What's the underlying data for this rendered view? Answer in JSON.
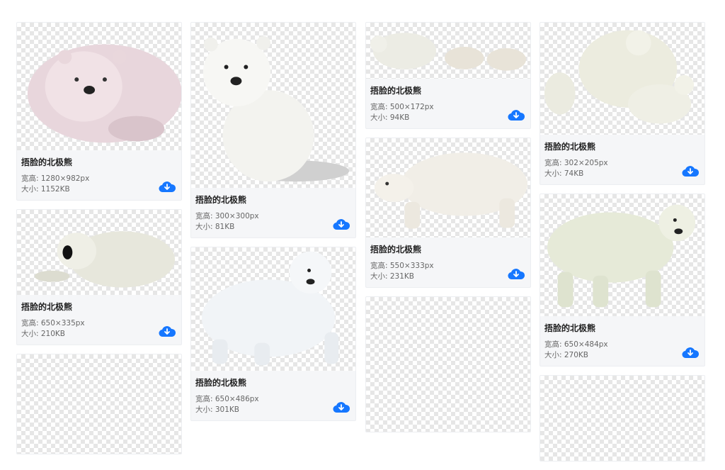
{
  "cards": [
    {
      "title": "捂脸的北极熊",
      "size_line": "宽高: 1280×982px",
      "file_line": "大小: 1152KB",
      "icon": "cloud-download-icon"
    },
    {
      "title": "捂脸的北极熊",
      "size_line": "宽高: 650×335px",
      "file_line": "大小: 210KB",
      "icon": "cloud-download-icon"
    },
    {
      "title": "捂脸的北极熊",
      "size_line": "宽高: 300×300px",
      "file_line": "大小: 81KB",
      "icon": "cloud-download-icon"
    },
    {
      "title": "捂脸的北极熊",
      "size_line": "宽高: 650×486px",
      "file_line": "大小: 301KB",
      "icon": "cloud-download-icon"
    },
    {
      "title": "捂脸的北极熊",
      "size_line": "宽高: 500×172px",
      "file_line": "大小: 94KB",
      "icon": "cloud-download-icon"
    },
    {
      "title": "捂脸的北极熊",
      "size_line": "宽高: 550×333px",
      "file_line": "大小: 231KB",
      "icon": "cloud-download-icon"
    },
    {
      "title": "捂脸的北极熊",
      "size_line": "宽高: 302×205px",
      "file_line": "大小: 74KB",
      "icon": "cloud-download-icon"
    },
    {
      "title": "捂脸的北极熊",
      "size_line": "宽高: 650×484px",
      "file_line": "大小: 270KB",
      "icon": "cloud-download-icon"
    }
  ],
  "colors": {
    "accent": "#1677ff",
    "card_bg": "#f5f6f8",
    "checker": "#e6e6e6"
  }
}
